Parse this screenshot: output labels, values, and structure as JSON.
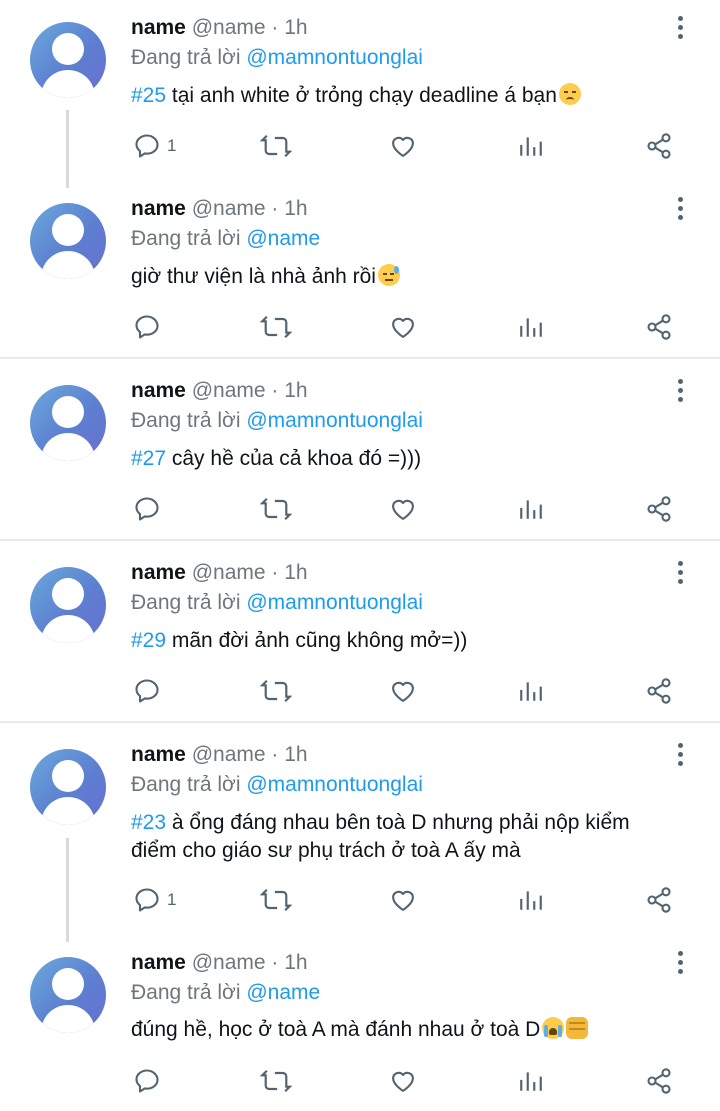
{
  "tweets": [
    {
      "name": "name",
      "handle": "@name",
      "dot": "·",
      "time": "1h",
      "reply_prefix": "Đang trả lời ",
      "reply_to": "@mamnontuonglai",
      "hashtag": "#25",
      "text": " tại anh white ở trỏng chạy deadline á bạn",
      "emoji": "disappointed-face",
      "reply_count": "1"
    },
    {
      "name": "name",
      "handle": "@name",
      "dot": "·",
      "time": "1h",
      "reply_prefix": "Đang trả lời ",
      "reply_to": "@name",
      "hashtag": "",
      "text": "giờ thư viện là nhà ảnh rồi",
      "emoji": "downcast-sweat-face",
      "reply_count": ""
    },
    {
      "name": "name",
      "handle": "@name",
      "dot": "·",
      "time": "1h",
      "reply_prefix": "Đang trả lời ",
      "reply_to": "@mamnontuonglai",
      "hashtag": "#27",
      "text": " cây hề của cả khoa đó =)))",
      "emoji": "",
      "reply_count": ""
    },
    {
      "name": "name",
      "handle": "@name",
      "dot": "·",
      "time": "1h",
      "reply_prefix": "Đang trả lời ",
      "reply_to": "@mamnontuonglai",
      "hashtag": "#29",
      "text": " mãn đời ảnh cũng không mở=))",
      "emoji": "",
      "reply_count": ""
    },
    {
      "name": "name",
      "handle": "@name",
      "dot": "·",
      "time": "1h",
      "reply_prefix": "Đang trả lời ",
      "reply_to": "@mamnontuonglai",
      "hashtag": "#23",
      "text": " à ổng đáng nhau bên toà D nhưng phải nộp kiểm điểm cho giáo sư phụ trách ở toà A ấy mà",
      "emoji": "",
      "reply_count": "1"
    },
    {
      "name": "name",
      "handle": "@name",
      "dot": "·",
      "time": "1h",
      "reply_prefix": "Đang trả lời ",
      "reply_to": "@name",
      "hashtag": "",
      "text": "đúng hề, học ở toà A mà đánh nhau ở toà D",
      "emoji": "crying-face,oncoming-fist",
      "reply_count": ""
    }
  ],
  "icons": {
    "reply": "speech-bubble-icon",
    "retweet": "retweet-icon",
    "like": "heart-icon",
    "analytics": "bar-chart-icon",
    "share": "share-icon",
    "more": "kebab-menu-icon"
  },
  "colors": {
    "link": "#1d9bf0",
    "secondary_text": "#6e767d",
    "icon": "#536471",
    "divider": "#e7e9ea"
  }
}
